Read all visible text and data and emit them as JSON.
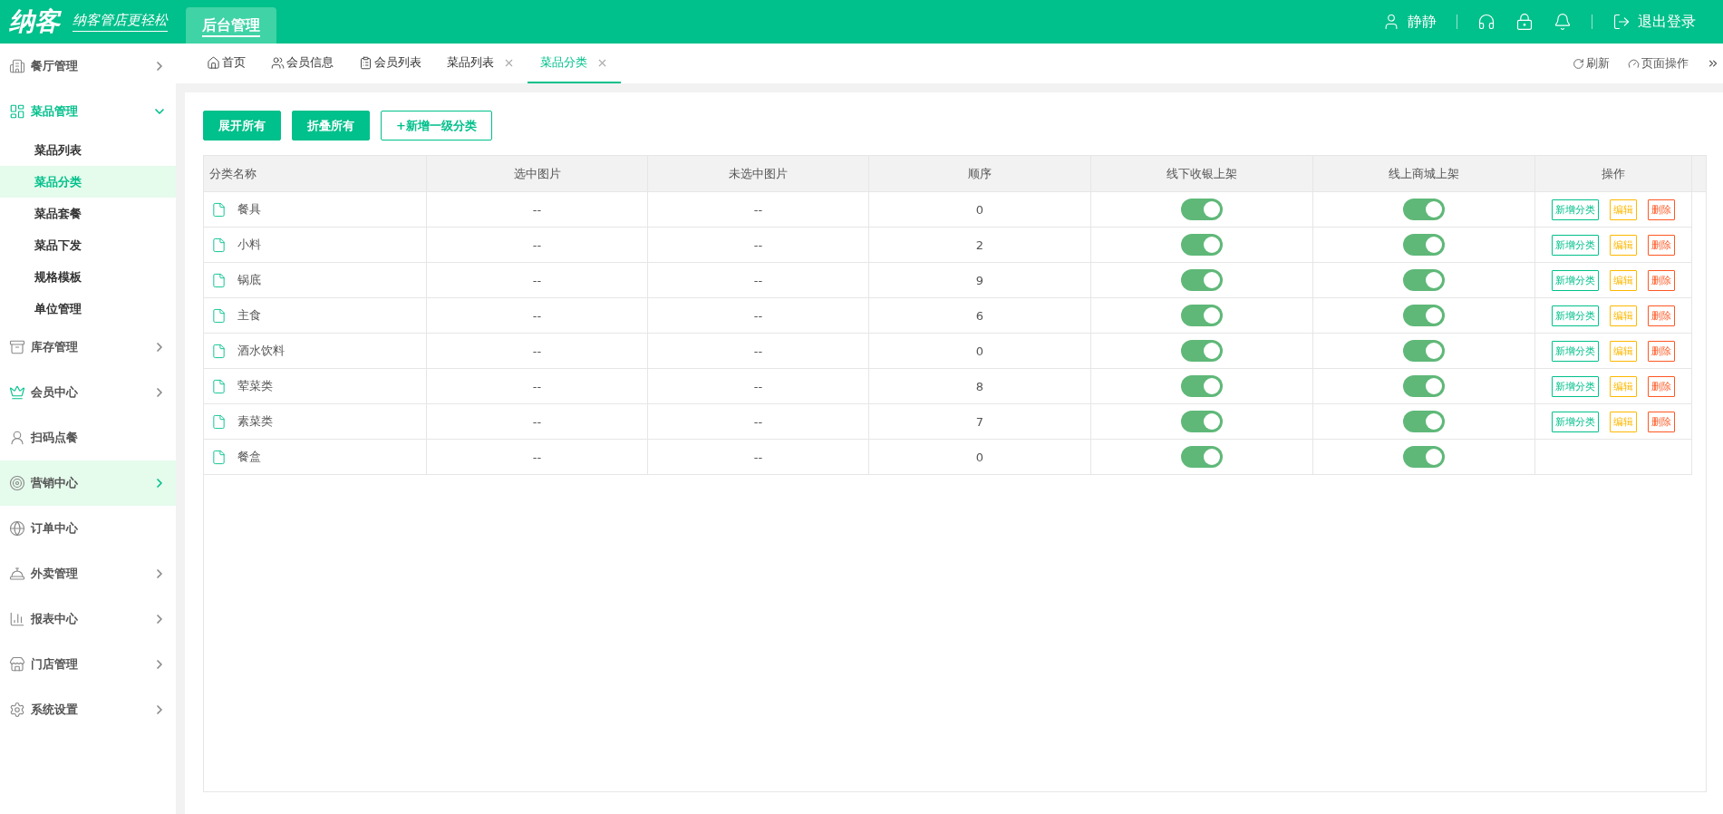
{
  "header": {
    "logo": "纳客",
    "slogan": "纳客管店更轻松",
    "module_tab": {
      "label": "后台管理",
      "selected": true
    },
    "user": "静静",
    "logout": "退出登录"
  },
  "sidebar": {
    "items": [
      {
        "label": "餐厅管理",
        "has_arrow": true,
        "expanded": false,
        "hovered": false
      },
      {
        "label": "菜品管理",
        "has_arrow": true,
        "expanded": true,
        "hovered": false,
        "children": [
          {
            "label": "菜品列表",
            "selected": false
          },
          {
            "label": "菜品分类",
            "selected": true
          },
          {
            "label": "菜品套餐",
            "selected": false
          },
          {
            "label": "菜品下发",
            "selected": false
          },
          {
            "label": "规格模板",
            "selected": false
          },
          {
            "label": "单位管理",
            "selected": false
          }
        ]
      },
      {
        "label": "库存管理",
        "has_arrow": true,
        "expanded": false,
        "hovered": false
      },
      {
        "label": "会员中心",
        "has_arrow": true,
        "expanded": false,
        "hovered": false
      },
      {
        "label": "扫码点餐",
        "has_arrow": false,
        "expanded": false,
        "hovered": false
      },
      {
        "label": "营销中心",
        "has_arrow": true,
        "expanded": false,
        "hovered": true
      },
      {
        "label": "订单中心",
        "has_arrow": false,
        "expanded": false,
        "hovered": false
      },
      {
        "label": "外卖管理",
        "has_arrow": true,
        "expanded": false,
        "hovered": false
      },
      {
        "label": "报表中心",
        "has_arrow": true,
        "expanded": false,
        "hovered": false
      },
      {
        "label": "门店管理",
        "has_arrow": true,
        "expanded": false,
        "hovered": false
      },
      {
        "label": "系统设置",
        "has_arrow": true,
        "expanded": false,
        "hovered": false
      }
    ]
  },
  "tabs": [
    {
      "label": "首页",
      "closable": false,
      "selected": false
    },
    {
      "label": "会员信息",
      "closable": false,
      "selected": false
    },
    {
      "label": "会员列表",
      "closable": false,
      "selected": false
    },
    {
      "label": "菜品列表",
      "closable": true,
      "selected": false
    },
    {
      "label": "菜品分类",
      "closable": true,
      "selected": true
    }
  ],
  "tab_actions": [
    "刷新",
    "页面操作"
  ],
  "toolbar": [
    {
      "label": "展开所有",
      "kind": "solid"
    },
    {
      "label": "折叠所有",
      "kind": "solid"
    },
    {
      "label": "+新增一级分类",
      "kind": "outline"
    }
  ],
  "table": {
    "columns": [
      "分类名称",
      "选中图片",
      "未选中图片",
      "顺序",
      "线下收银上架",
      "线上商城上架",
      "操作"
    ],
    "rows": [
      {
        "name": "餐具",
        "selected_image": "--",
        "unselected_image": "--",
        "order": "0",
        "offline_on": true,
        "online_on": true,
        "actions": [
          {
            "label": "新增分类",
            "kind": "add"
          },
          {
            "label": "编辑",
            "kind": "edit"
          },
          {
            "label": "删除",
            "kind": "delete"
          }
        ]
      },
      {
        "name": "小料",
        "selected_image": "--",
        "unselected_image": "--",
        "order": "2",
        "offline_on": true,
        "online_on": true,
        "actions": [
          {
            "label": "新增分类",
            "kind": "add"
          },
          {
            "label": "编辑",
            "kind": "edit"
          },
          {
            "label": "删除",
            "kind": "delete"
          }
        ]
      },
      {
        "name": "锅底",
        "selected_image": "--",
        "unselected_image": "--",
        "order": "9",
        "offline_on": true,
        "online_on": true,
        "actions": [
          {
            "label": "新增分类",
            "kind": "add"
          },
          {
            "label": "编辑",
            "kind": "edit"
          },
          {
            "label": "删除",
            "kind": "delete"
          }
        ]
      },
      {
        "name": "主食",
        "selected_image": "--",
        "unselected_image": "--",
        "order": "6",
        "offline_on": true,
        "online_on": true,
        "actions": [
          {
            "label": "新增分类",
            "kind": "add"
          },
          {
            "label": "编辑",
            "kind": "edit"
          },
          {
            "label": "删除",
            "kind": "delete"
          }
        ]
      },
      {
        "name": "酒水饮料",
        "selected_image": "--",
        "unselected_image": "--",
        "order": "0",
        "offline_on": true,
        "online_on": true,
        "actions": [
          {
            "label": "新增分类",
            "kind": "add"
          },
          {
            "label": "编辑",
            "kind": "edit"
          },
          {
            "label": "删除",
            "kind": "delete"
          }
        ]
      },
      {
        "name": "荤菜类",
        "selected_image": "--",
        "unselected_image": "--",
        "order": "8",
        "offline_on": true,
        "online_on": true,
        "actions": [
          {
            "label": "新增分类",
            "kind": "add"
          },
          {
            "label": "编辑",
            "kind": "edit"
          },
          {
            "label": "删除",
            "kind": "delete"
          }
        ]
      },
      {
        "name": "素菜类",
        "selected_image": "--",
        "unselected_image": "--",
        "order": "7",
        "offline_on": true,
        "online_on": true,
        "actions": [
          {
            "label": "新增分类",
            "kind": "add"
          },
          {
            "label": "编辑",
            "kind": "edit"
          },
          {
            "label": "删除",
            "kind": "delete"
          }
        ]
      },
      {
        "name": "餐盒",
        "selected_image": "--",
        "unselected_image": "--",
        "order": "0",
        "offline_on": true,
        "online_on": true
      }
    ]
  }
}
